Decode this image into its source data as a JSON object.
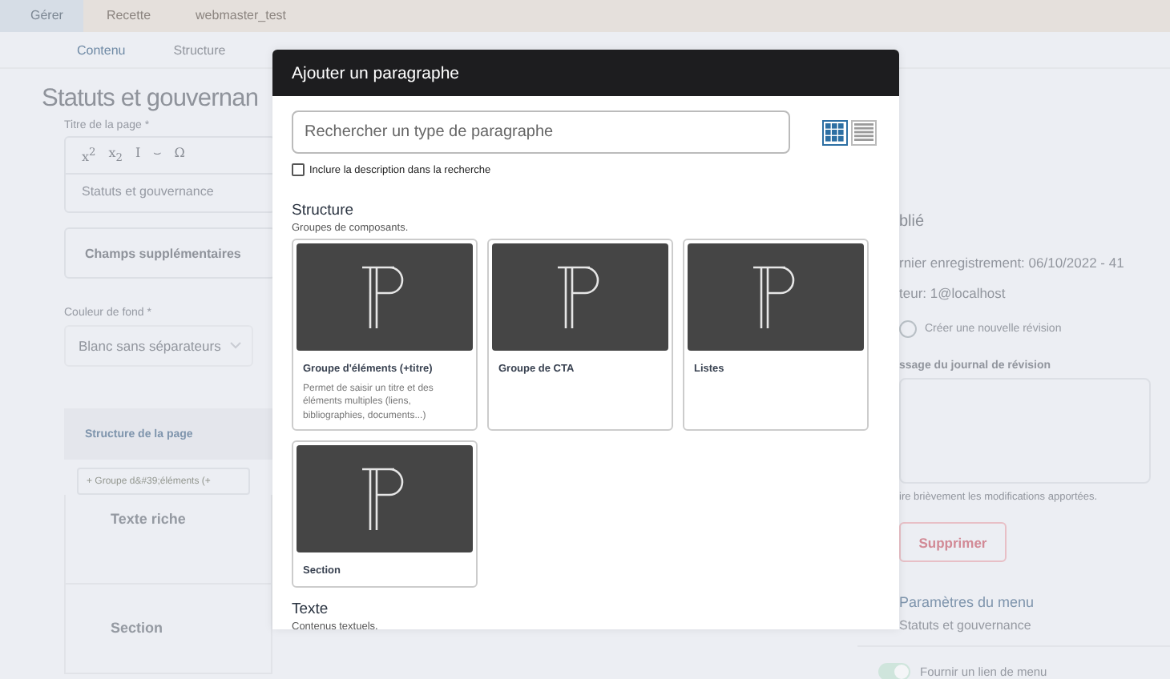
{
  "top_bar": [
    {
      "label": "Gérer",
      "selected": true
    },
    {
      "label": "Recette",
      "selected": false
    },
    {
      "label": "webmaster_test",
      "selected": false
    }
  ],
  "tabs": [
    {
      "label": "Contenu",
      "selected": true
    },
    {
      "label": "Structure",
      "selected": false
    }
  ],
  "page": {
    "title": "Statuts et gouvernan",
    "title_field": {
      "label": "Titre de la page *",
      "toolbar": [
        "x$^{2}$",
        "x$_{2}$",
        "I",
        "⌣",
        "Ω"
      ],
      "value": "Statuts et gouvernance"
    },
    "extra_fields": "Champs supplémentaires",
    "background": {
      "label": "Couleur de fond *",
      "value": "Blanc sans séparateurs"
    },
    "structure": {
      "title": "Structure de la page",
      "add_button": "+ Groupe d&#39;éléments (+",
      "items": [
        "Texte riche",
        "Section"
      ]
    }
  },
  "sidebar": {
    "status": "blié",
    "first_saved": "rnier enregistrement: 06/10/2022 - 41",
    "author": "teur: 1@localhost",
    "new_revision": {
      "label": "Créer une nouvelle révision",
      "on": false
    },
    "log": {
      "label": "ssage du journal de révision",
      "hint": "ire brièvement les modifications apportées."
    },
    "delete_button": "Supprimer",
    "menu": {
      "title": "Paramètres du menu",
      "subtitle": "Statuts et gouvernance"
    },
    "menu_link": {
      "label": "Fournir un lien de menu",
      "on": true
    }
  },
  "dialog": {
    "title": "Ajouter un paragraphe",
    "search": {
      "placeholder": "Rechercher un type de paragraphe"
    },
    "views": [
      {
        "kind": "grid",
        "selected": true
      },
      {
        "kind": "list",
        "selected": false
      }
    ],
    "include_description": {
      "label": "Inclure la description dans la recherche",
      "checked": false
    },
    "groups": [
      {
        "title": "Structure",
        "description": "Groupes de composants.",
        "items": [
          {
            "name": "Groupe d'éléments (+titre)",
            "description": "Permet de saisir un titre et des éléments multiples (liens, bibliographies, documents...)"
          },
          {
            "name": "Groupe de CTA"
          },
          {
            "name": "Listes"
          },
          {
            "name": "Section"
          }
        ]
      },
      {
        "title": "Texte",
        "description": "Contenus textuels."
      }
    ]
  }
}
